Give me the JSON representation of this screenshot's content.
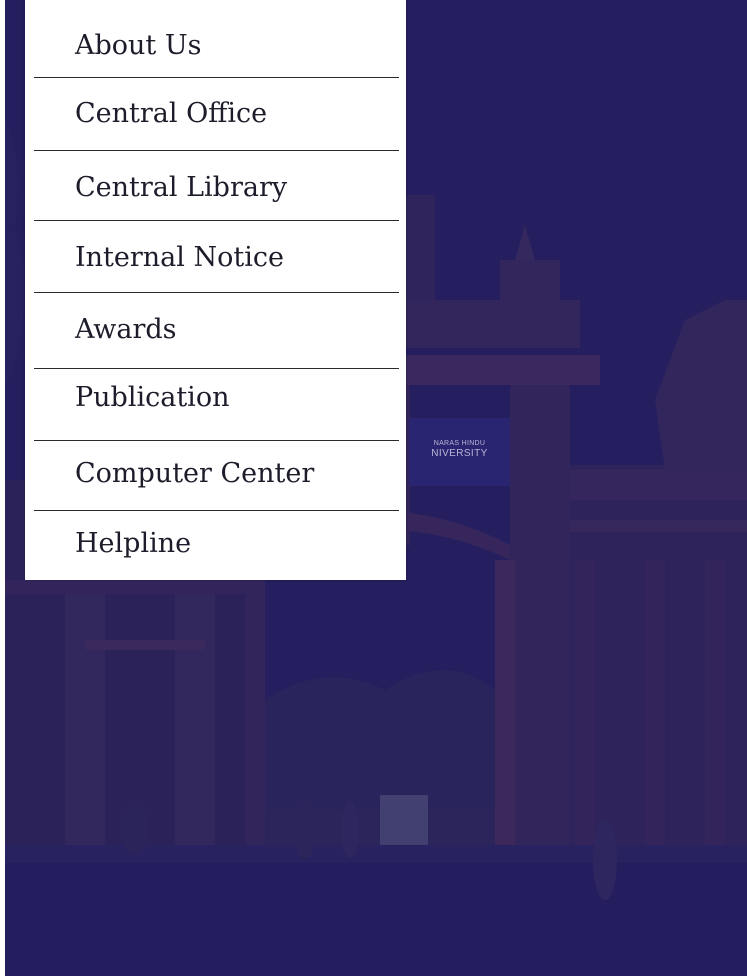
{
  "background": {
    "sign_line1": "NARAS HINDU",
    "sign_line2": "NIVERSITY",
    "overlay_color": "#241e60"
  },
  "menu": {
    "items": [
      {
        "label": "About Us",
        "icon": "none"
      },
      {
        "label": "Central Office",
        "icon": "none"
      },
      {
        "label": "Central Library",
        "icon": "none"
      },
      {
        "label": "Internal Notice",
        "icon": "none"
      },
      {
        "label": "Awards",
        "icon": "none"
      },
      {
        "label": "Publication",
        "icon": "none"
      },
      {
        "label": "Computer Center",
        "icon": "none"
      },
      {
        "label": "Helpline",
        "icon": "none"
      }
    ]
  }
}
